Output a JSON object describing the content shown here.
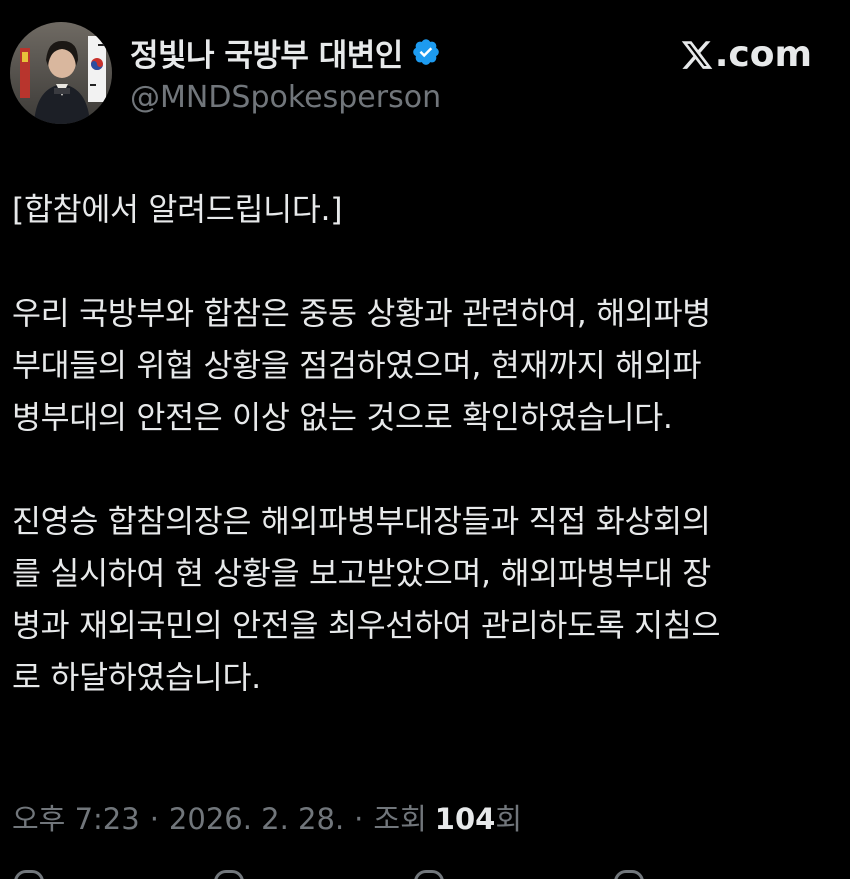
{
  "author": {
    "display_name": "정빛나 국방부 대변인",
    "handle": "@MNDSpokesperson",
    "verified_icon": "verified-badge-icon",
    "avatar_icon": "profile-photo"
  },
  "brand": {
    "label": ".com",
    "logo_icon": "x-logo-icon"
  },
  "tweet": {
    "paragraphs": [
      "[합참에서 알려드립니다.]",
      "우리 국방부와 합참은 중동 상황과 관련하여, 해외파병\n부대들의 위협 상황을 점검하였으며, 현재까지 해외파\n병부대의 안전은 이상 없는 것으로 확인하였습니다.",
      "진영승 합참의장은 해외파병부대장들과 직접 화상회의\n를 실시하여 현 상황을 보고받았으며, 해외파병부대 장\n병과 재외국민의 안전을 최우선하여 관리하도록 지침으\n로 하달하였습니다."
    ]
  },
  "meta": {
    "time": "오후 7:23",
    "separator": "·",
    "date": "2026. 2. 28.",
    "views_label": "조회",
    "views_count": "104",
    "views_suffix": "회"
  },
  "colors": {
    "background": "#000000",
    "text": "#e7e9ea",
    "muted": "#71767b",
    "verified": "#1d9bf0"
  }
}
